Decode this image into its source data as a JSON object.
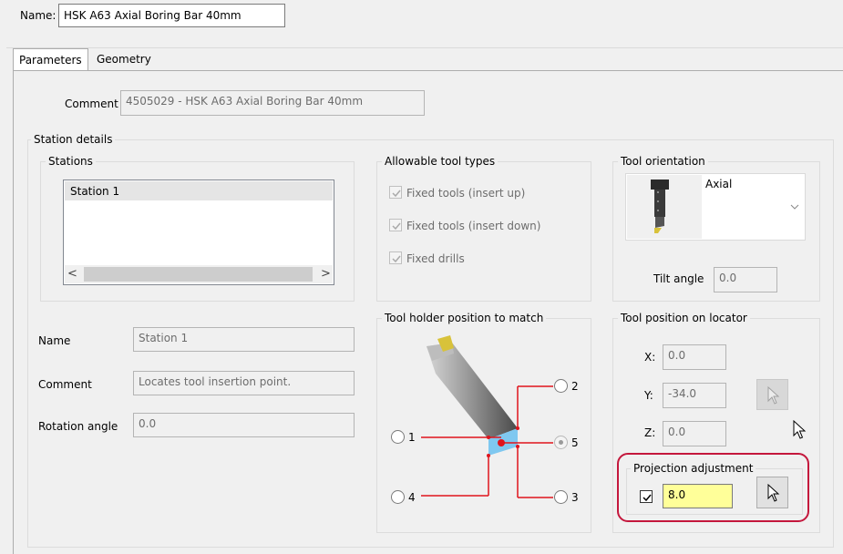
{
  "name_label": "Name:",
  "name_value": "HSK A63 Axial Boring Bar 40mm",
  "tabs": [
    {
      "label": "Parameters",
      "active": true
    },
    {
      "label": "Geometry",
      "active": false
    }
  ],
  "comment": {
    "label": "Comment",
    "value": "4505029 - HSK A63 Axial Boring Bar 40mm"
  },
  "station_details": {
    "title": "Station details",
    "stations": {
      "title": "Stations",
      "items": [
        "Station 1"
      ],
      "scroll_left": "<",
      "scroll_right": ">"
    },
    "allowable_tool_types": {
      "title": "Allowable tool types",
      "options": [
        {
          "label": "Fixed tools (insert up)",
          "checked": true
        },
        {
          "label": "Fixed tools (insert down)",
          "checked": true
        },
        {
          "label": "Fixed drills",
          "checked": true
        }
      ]
    },
    "tool_orientation": {
      "title": "Tool orientation",
      "selected": "Axial",
      "tilt_label": "Tilt angle",
      "tilt_value": "0.0"
    },
    "station_name": {
      "label": "Name",
      "value": "Station 1"
    },
    "station_comment": {
      "label": "Comment",
      "value": "Locates tool insertion point."
    },
    "rotation_angle": {
      "label": "Rotation angle",
      "value": "0.0"
    },
    "holder_position": {
      "title": "Tool holder position to match",
      "positions": [
        {
          "label": "1",
          "selected": false
        },
        {
          "label": "2",
          "selected": false
        },
        {
          "label": "3",
          "selected": false
        },
        {
          "label": "4",
          "selected": false
        },
        {
          "label": "5",
          "selected": true
        }
      ],
      "marker_color": "#e0141c",
      "holder_color": "#8c8c8c",
      "insert_color": "#d8c23a",
      "face_color": "#7fc8f0"
    },
    "tool_position": {
      "title": "Tool position on locator",
      "x_label": "X:",
      "x_value": "0.0",
      "y_label": "Y:",
      "y_value": "-34.0",
      "z_label": "Z:",
      "z_value": "0.0",
      "projection": {
        "title": "Projection adjustment",
        "checked": true,
        "value": "8.0",
        "highlight_color": "#ffff99",
        "ring_color": "#c4173c"
      }
    }
  }
}
